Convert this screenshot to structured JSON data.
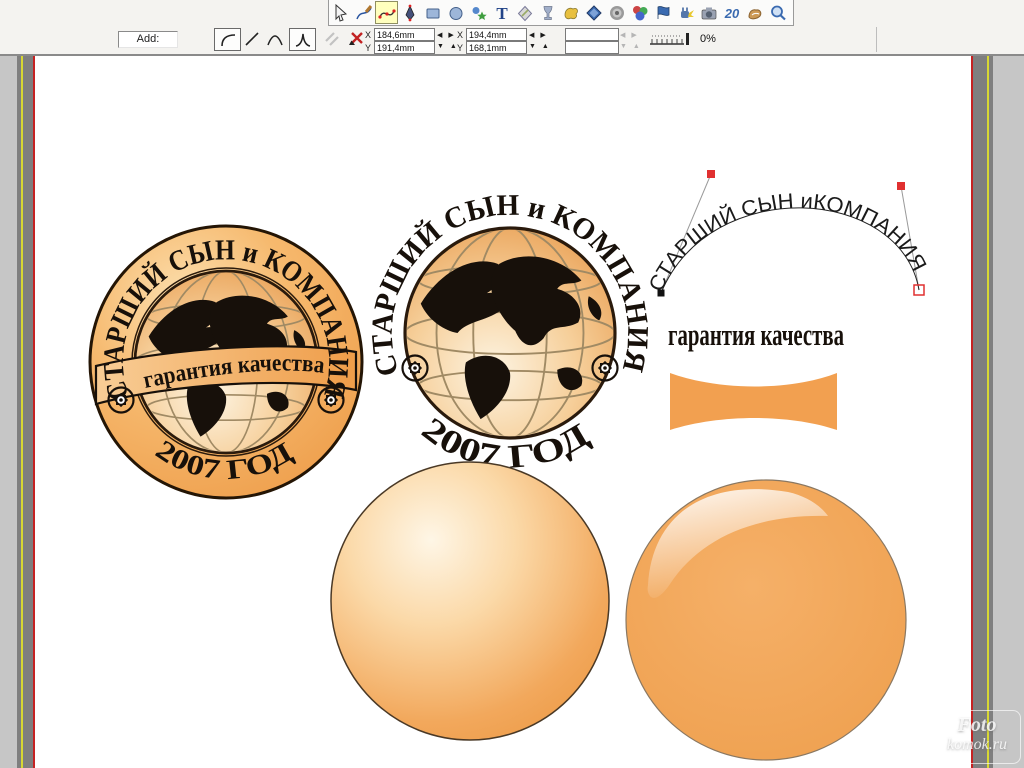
{
  "toolbar": {
    "selected_tool": "shape-editor-tool",
    "tools": [
      "selector-tool",
      "freehand-tool",
      "shape-editor-tool",
      "pen-tool",
      "rectangle-tool",
      "ellipse-tool",
      "quickshape-tool",
      "text-tool",
      "fill-tool",
      "transparency-tool",
      "mould-tool",
      "blend-tool",
      "contour-tool",
      "extrude-tool",
      "flag-tool",
      "plugin-effects-tool",
      "photo-tool",
      "frame-tool",
      "push-tool",
      "zoom-tool"
    ],
    "icon_glyphs": {
      "text_tool": "T",
      "frame_tool": "20"
    }
  },
  "property_bar": {
    "add_label": "Add:",
    "x_label": "X",
    "y_label": "Y",
    "point1": {
      "x": "184,6mm",
      "y": "191,4mm"
    },
    "point2": {
      "x": "194,4mm",
      "y": "168,1mm"
    },
    "smoothness": "0%"
  },
  "artwork": {
    "company_text": "СТАРШИЙ СЫН и КОМПАНИЯ",
    "company_text_path": "СТАРШИЙ СЫН иКОМПАНИЯ",
    "year_text": "2007 ГОД",
    "banner_text": "гарантия качества",
    "quality_text": "гарантия качества",
    "colors": {
      "orange": "#f2a252",
      "orange_light": "#fbd9a8",
      "ink": "#17100a",
      "node_red": "#e03030"
    }
  },
  "watermark": {
    "line1": "Foto",
    "line2": "komok.ru"
  }
}
